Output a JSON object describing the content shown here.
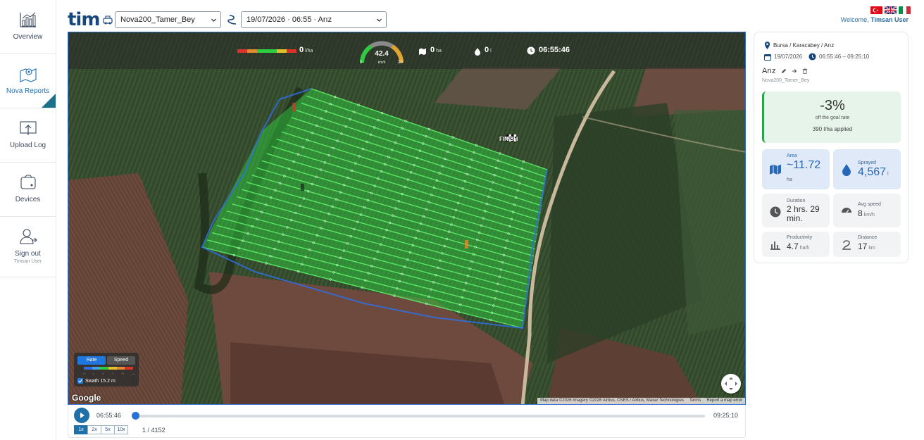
{
  "sidebar": {
    "items": [
      {
        "label": "Overview"
      },
      {
        "label": "Nova Reports"
      },
      {
        "label": "Upload Log"
      },
      {
        "label": "Devices"
      },
      {
        "label": "Sign out",
        "sub": "Timsan User"
      }
    ]
  },
  "header": {
    "logo": "tim",
    "device_select": "Nova200_Tamer_Bey",
    "session_select": "19/07/2026 · 06:55 · Arız",
    "welcome_prefix": "Welcome,",
    "welcome_user": "Timsan User"
  },
  "hud": {
    "rate": "0",
    "rate_unit": "l/ha",
    "speed": "42.4",
    "speed_unit": "km/h",
    "speed_min": "0",
    "speed_max": "20",
    "area": "0",
    "area_unit": "ha",
    "volume": "0",
    "volume_unit": "l",
    "time": "06:55:46"
  },
  "map": {
    "finish_label": "FINISH",
    "legend": {
      "rate_tab": "Rate",
      "speed_tab": "Speed",
      "swath": "Swath 15.2 m",
      "ticks": [
        "↓↓",
        "↓",
        "✓",
        "↑",
        "↑↑",
        "—"
      ]
    },
    "google": "Google",
    "attribution": [
      "Map data ©2026 Imagery ©2026 Airbus, CNES / Airbus, Maxar Technologies",
      "Terms",
      "Report a map error"
    ]
  },
  "playback": {
    "start_time": "06:55:46",
    "end_time": "09:25:10",
    "progress": 0.0,
    "speeds": [
      "1x",
      "2x",
      "5x",
      "10x"
    ],
    "active_speed": "1x",
    "frame_counter": "1 / 4152"
  },
  "panel": {
    "location": "Bursa / Karacabey / Arız",
    "date": "19/07/2026",
    "time_range": "06:55:46 – 09:25:10",
    "field_name": "Arız",
    "device_name": "Nova200_Tamer_Bey",
    "goal_pct": "-3%",
    "goal_sub": "off the goal rate",
    "goal_applied": "390 l/ha applied",
    "area_label": "Area",
    "area_value": "~11.72",
    "area_unit": "ha",
    "sprayed_label": "Sprayed",
    "sprayed_value": "4,567",
    "sprayed_unit": "l",
    "duration_label": "Duration",
    "duration_value": "2 hrs. 29 min.",
    "avg_speed_label": "Avg speed",
    "avg_speed_value": "8",
    "avg_speed_unit": "km/h",
    "productivity_label": "Productivity",
    "productivity_value": "4.7",
    "productivity_unit": "ha/h",
    "distance_label": "Distance",
    "distance_value": "17",
    "distance_unit": "km"
  },
  "colors": {
    "brand": "#17477d",
    "accent": "#1f6fa8",
    "goal_green": "#2aa24c",
    "swath_green": "#2ecc40",
    "track_blue": "#2f6fe0"
  }
}
